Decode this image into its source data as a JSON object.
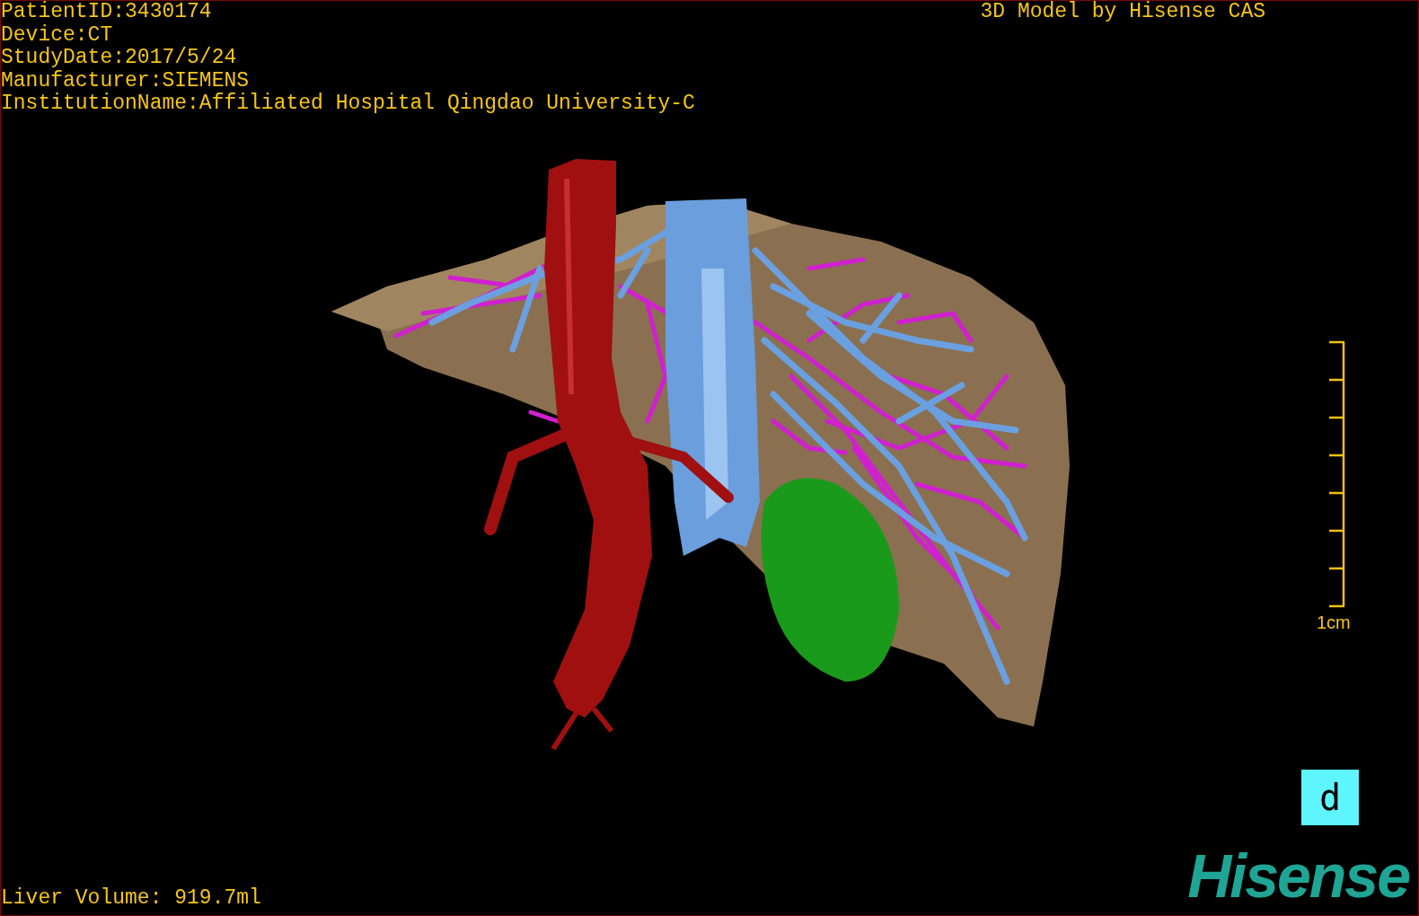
{
  "study_info": [
    "PatientID:3430174",
    "Device:CT",
    "StudyDate:2017/5/24",
    "Manufacturer:SIEMENS",
    "InstitutionName:Affiliated Hospital Qingdao University-C"
  ],
  "credit": "3D Model by Hisense CAS",
  "scale_bar": {
    "label": "1cm"
  },
  "orientation_marker": {
    "label": "d"
  },
  "liver_volume": "Liver Volume: 919.7ml",
  "logo": "Hisense"
}
